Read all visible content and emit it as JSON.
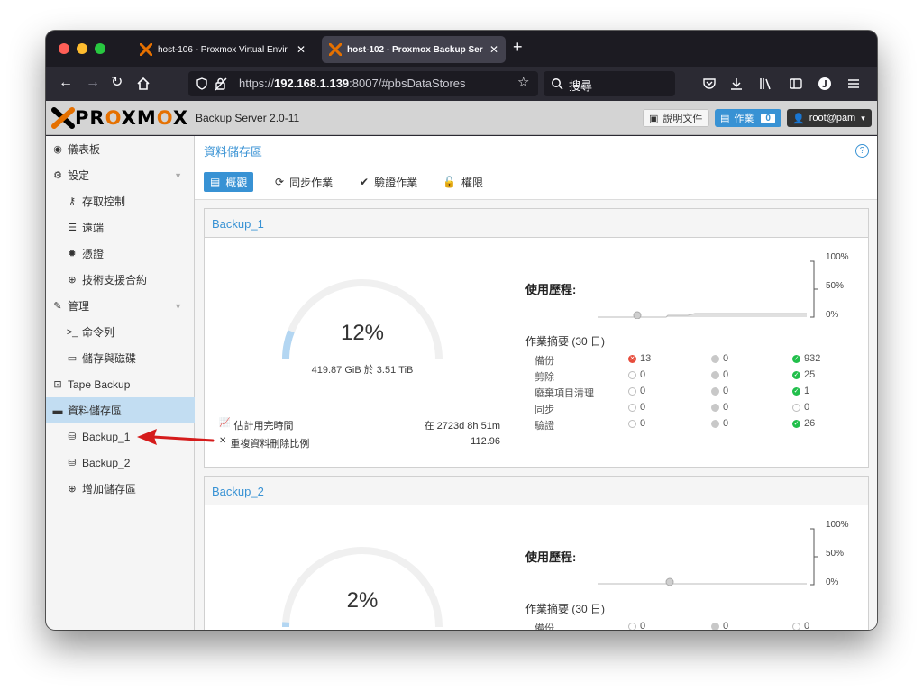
{
  "browser": {
    "tabs": [
      {
        "title": "host-106 - Proxmox Virtual Envir"
      },
      {
        "title": "host-102 - Proxmox Backup Ser"
      }
    ],
    "url_prefix": "https://",
    "url_host": "192.168.1.139",
    "url_rest": ":8007/#pbsDataStores",
    "search_placeholder": "搜尋"
  },
  "header": {
    "logo_text_1": "PR",
    "logo_text_o1": "O",
    "logo_text_2": "XM",
    "logo_text_o2": "O",
    "logo_text_3": "X",
    "app_version": "Backup Server 2.0-11",
    "docs_label": "說明文件",
    "tasks_label": "作業",
    "tasks_count": "0",
    "user_label": "root@pam"
  },
  "sidebar": {
    "items": [
      {
        "label": "儀表板"
      },
      {
        "label": "設定"
      },
      {
        "label": "存取控制"
      },
      {
        "label": "遠端"
      },
      {
        "label": "憑證"
      },
      {
        "label": "技術支援合約"
      },
      {
        "label": "管理"
      },
      {
        "label": "命令列"
      },
      {
        "label": "儲存與磁碟"
      },
      {
        "label": "Tape Backup"
      },
      {
        "label": "資料儲存區"
      },
      {
        "label": "Backup_1"
      },
      {
        "label": "Backup_2"
      },
      {
        "label": "增加儲存區"
      }
    ]
  },
  "main": {
    "title": "資料儲存區",
    "tabs": [
      {
        "label": "概觀"
      },
      {
        "label": "同步作業"
      },
      {
        "label": "驗證作業"
      },
      {
        "label": "權限"
      }
    ]
  },
  "datastores": [
    {
      "name": "Backup_1",
      "usage_percent": "12%",
      "usage_fraction": 0.12,
      "usage_detail": "419.87 GiB 於 3.51 TiB",
      "est_full_label": "估計用完時間",
      "est_full_value": "在 2723d 8h 51m",
      "dedup_label": "重複資料刪除比例",
      "dedup_value": "112.96",
      "history_label": "使用歷程:",
      "axis": [
        "100%",
        "50%",
        "0%"
      ],
      "jobs_title": "作業摘要 (30 日)",
      "jobs": [
        {
          "name": "備份",
          "error": "13",
          "warning": "0",
          "ok": "932"
        },
        {
          "name": "剪除",
          "error": "0",
          "warning": "0",
          "ok": "25"
        },
        {
          "name": "廢棄項目清理",
          "error": "0",
          "warning": "0",
          "ok": "1"
        },
        {
          "name": "同步",
          "error": "0",
          "warning": "0",
          "ok": "0"
        },
        {
          "name": "驗證",
          "error": "0",
          "warning": "0",
          "ok": "26"
        }
      ]
    },
    {
      "name": "Backup_2",
      "usage_percent": "2%",
      "usage_fraction": 0.02,
      "history_label": "使用歷程:",
      "axis": [
        "100%",
        "50%",
        "0%"
      ],
      "jobs_title": "作業摘要 (30 日)",
      "jobs": [
        {
          "name": "備份",
          "error": "0",
          "warning": "0",
          "ok": "0"
        }
      ]
    }
  ],
  "colors": {
    "accent": "#3892d4",
    "error": "#e74c3c",
    "ok": "#21bf4b",
    "logo_orange": "#e57000",
    "annotation_arrow": "#d51b1b"
  }
}
